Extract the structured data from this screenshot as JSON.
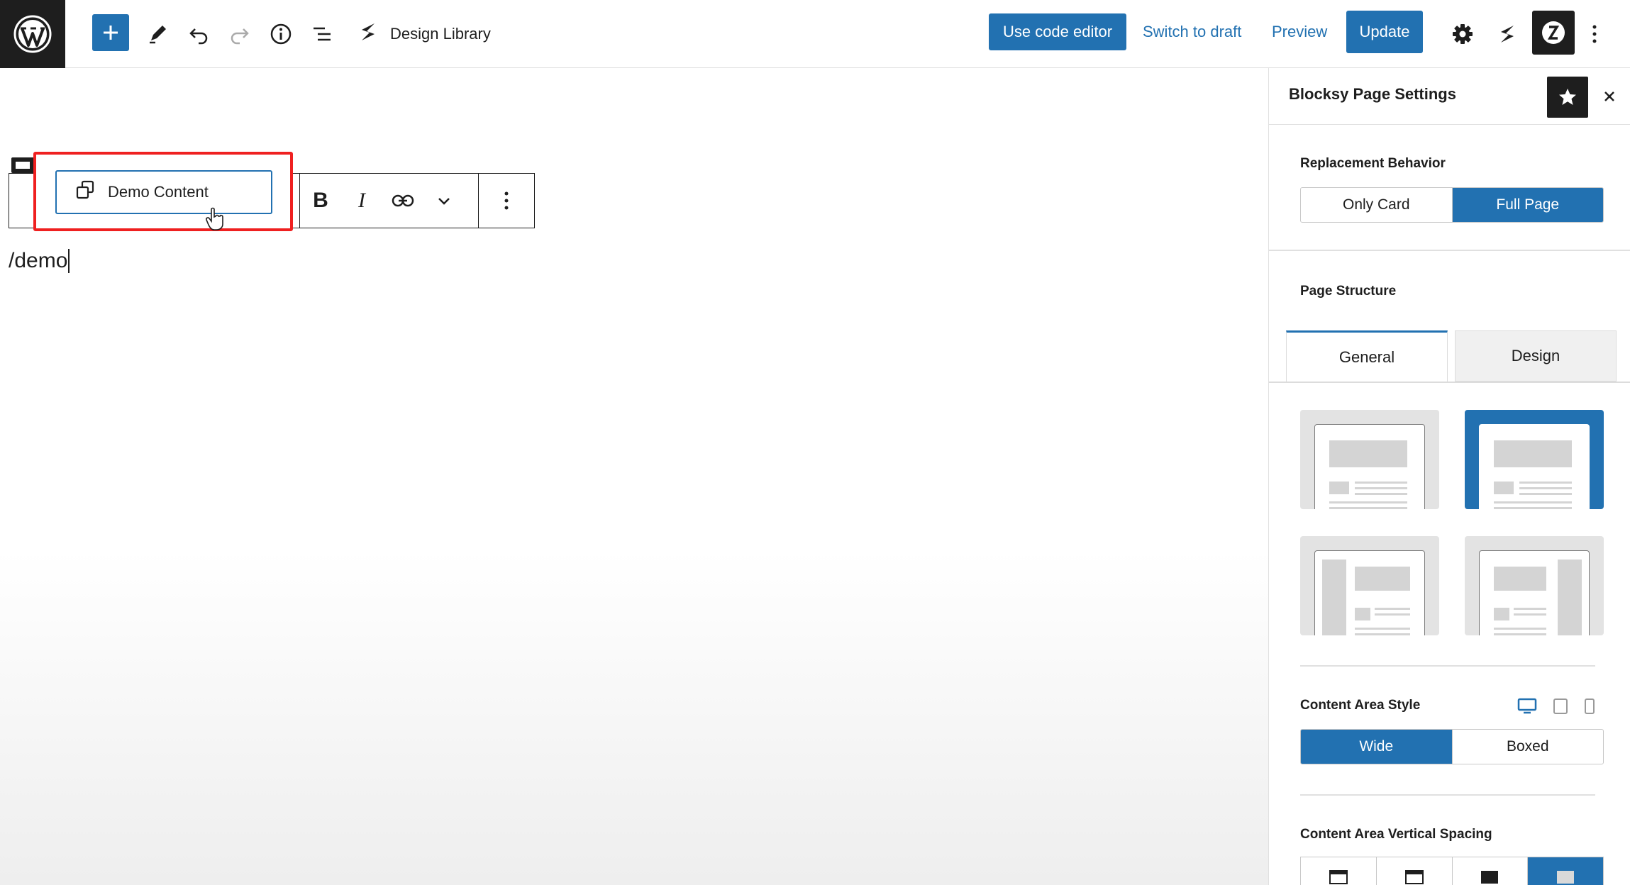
{
  "topbar": {
    "doc_title": "Design Library",
    "use_code_editor": "Use code editor",
    "switch_to_draft": "Switch to draft",
    "preview": "Preview",
    "update": "Update"
  },
  "editor": {
    "inserter_option": "Demo Content",
    "slash_command": "/demo",
    "format_bold": "B",
    "format_italic": "I"
  },
  "sidebar": {
    "title": "Blocksy Page Settings",
    "replacement_behavior": {
      "label": "Replacement Behavior",
      "options": [
        "Only Card",
        "Full Page"
      ],
      "selected": "Full Page"
    },
    "page_structure": {
      "label": "Page Structure",
      "tabs": [
        "General",
        "Design"
      ],
      "active_tab": "General",
      "layouts": [
        "no-sidebar",
        "no-sidebar-narrow",
        "left-sidebar",
        "right-sidebar"
      ],
      "selected_layout": "no-sidebar-narrow"
    },
    "content_area_style": {
      "label": "Content Area Style",
      "options": [
        "Wide",
        "Boxed"
      ],
      "selected": "Wide",
      "devices": [
        "desktop-icon",
        "tablet-icon",
        "mobile-icon"
      ],
      "active_device": "desktop-icon"
    },
    "content_area_vertical_spacing": {
      "label": "Content Area Vertical Spacing"
    }
  },
  "colors": {
    "accent": "#2271b1",
    "dark": "#1e1e1e",
    "highlight": "#ef2020"
  }
}
